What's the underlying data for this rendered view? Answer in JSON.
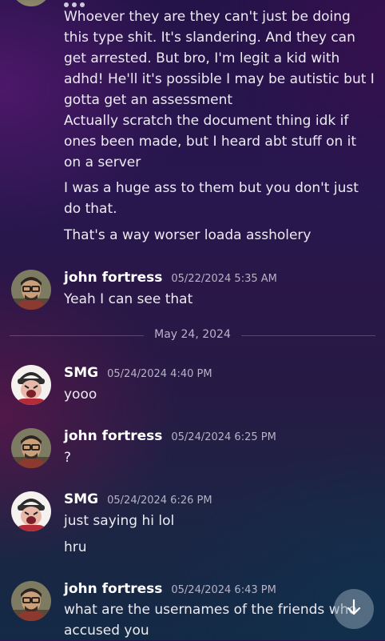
{
  "top_continuation": {
    "lines": [
      "Whoever they are they can't just be doing this type shit. It's slandering. And they can get arrested. But bro, I'm legit a kid with adhd! He'll it's possible I may be autistic but I gotta get an assessment",
      "Actually scratch the document thing idk if ones been made, but I heard abt stuff on it on a server",
      "I was a huge ass to them but you don't just do that.",
      "That's a way worser loada assholery"
    ]
  },
  "date_divider": {
    "label": "May 24, 2024"
  },
  "messages": [
    {
      "author": "john fortress",
      "timestamp": "05/22/2024 5:35 AM",
      "avatar_icon": "john-fortress-avatar-icon",
      "lines": [
        "Yeah I can see that"
      ]
    },
    {
      "author": "SMG",
      "timestamp": "05/24/2024 4:40 PM",
      "avatar_icon": "smg-avatar-icon",
      "lines": [
        "yooo"
      ]
    },
    {
      "author": "john fortress",
      "timestamp": "05/24/2024 6:25 PM",
      "avatar_icon": "john-fortress-avatar-icon",
      "lines": [
        "?"
      ]
    },
    {
      "author": "SMG",
      "timestamp": "05/24/2024 6:26 PM",
      "avatar_icon": "smg-avatar-icon",
      "lines": [
        "just saying hi lol",
        "hru"
      ]
    },
    {
      "author": "john fortress",
      "timestamp": "05/24/2024 6:43 PM",
      "avatar_icon": "john-fortress-avatar-icon",
      "lines": [
        "what are the usernames of the friends who accused you"
      ]
    }
  ],
  "scroll_button": {
    "icon": "arrow-down-icon"
  },
  "colors": {
    "author_name": "#ffffff",
    "timestamp": "#b7b2c6",
    "message_text": "#eceaf2",
    "divider_line": "#c8c3dc"
  }
}
